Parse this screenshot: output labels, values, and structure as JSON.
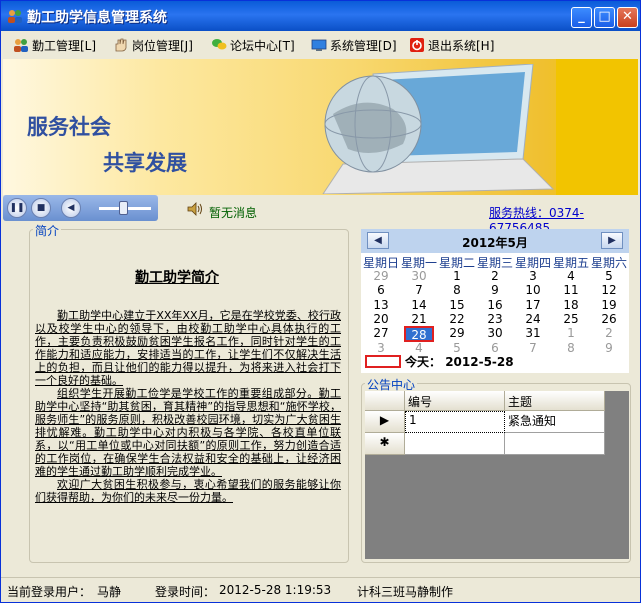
{
  "window": {
    "title": "勤工助学信息管理系统"
  },
  "menu": [
    {
      "label": "勤工管理[L]",
      "icon": "people-icon"
    },
    {
      "label": "岗位管理[J]",
      "icon": "hand-icon"
    },
    {
      "label": "论坛中心[T]",
      "icon": "chat-icon"
    },
    {
      "label": "系统管理[D]",
      "icon": "monitor-icon"
    },
    {
      "label": "退出系统[H]",
      "icon": "exit-icon"
    }
  ],
  "banner": {
    "line1": "服务社会",
    "line2": "共享发展"
  },
  "status": {
    "message": "暂无消息",
    "hotline": "服务热线：0374-67756485"
  },
  "intro": {
    "legend": "简介",
    "title": "勤工助学简介",
    "paragraphs": [
      "勤工助学中心建立于XX年XX月，它是在学校党委、校行政以及校学生中心的领导下，由校勤工助学中心具体执行的工作，主要负责积极鼓励贫困学生报名工作，同时针对学生的工作能力和适应能力，安排适当的工作，让学生们不仅解决生活上的负担，而且让他们的能力得以提升，为将来进入社会打下一个良好的基础。",
      "组织学生开展勤工俭学是学校工作的重要组成部分。勤工助学中心坚持“助其贫困，育其精神”的指导思想和“施怀学校，服务师生”的服务原则，积极改善校园环境，切实为广大贫困生排忧解难。勤工助学中心对内积极与各学院、各校直单位联系，以“用工单位或中心对同扶额”的原则工作，努力创造合适的工作岗位，在确保学生合法权益和安全的基础上，让经济困难的学生通过勤工助学顺利完成学业。",
      "欢迎广大贫困生积极参与，衷心希望我们的服务能够让你们获得帮助，为你们的未来尽一份力量。"
    ]
  },
  "calendar": {
    "month_label": "2012年5月",
    "weekdays": [
      "星期日",
      "星期一",
      "星期二",
      "星期三",
      "星期四",
      "星期五",
      "星期六"
    ],
    "weeks": [
      [
        {
          "d": "29",
          "o": true
        },
        {
          "d": "30",
          "o": true
        },
        {
          "d": "1"
        },
        {
          "d": "2"
        },
        {
          "d": "3"
        },
        {
          "d": "4"
        },
        {
          "d": "5"
        }
      ],
      [
        {
          "d": "6"
        },
        {
          "d": "7"
        },
        {
          "d": "8"
        },
        {
          "d": "9"
        },
        {
          "d": "10"
        },
        {
          "d": "11"
        },
        {
          "d": "12"
        }
      ],
      [
        {
          "d": "13"
        },
        {
          "d": "14"
        },
        {
          "d": "15"
        },
        {
          "d": "16"
        },
        {
          "d": "17"
        },
        {
          "d": "18"
        },
        {
          "d": "19"
        }
      ],
      [
        {
          "d": "20"
        },
        {
          "d": "21"
        },
        {
          "d": "22"
        },
        {
          "d": "23"
        },
        {
          "d": "24"
        },
        {
          "d": "25"
        },
        {
          "d": "26"
        }
      ],
      [
        {
          "d": "27"
        },
        {
          "d": "28",
          "s": true
        },
        {
          "d": "29"
        },
        {
          "d": "30"
        },
        {
          "d": "31"
        },
        {
          "d": "1",
          "o": true
        },
        {
          "d": "2",
          "o": true
        }
      ],
      [
        {
          "d": "3",
          "o": true
        },
        {
          "d": "4",
          "o": true
        },
        {
          "d": "5",
          "o": true
        },
        {
          "d": "6",
          "o": true
        },
        {
          "d": "7",
          "o": true
        },
        {
          "d": "8",
          "o": true
        },
        {
          "d": "9",
          "o": true
        }
      ]
    ],
    "today_label": "今天：",
    "today_value": "2012-5-28"
  },
  "notice": {
    "legend": "公告中心",
    "columns": [
      "编号",
      "主题"
    ],
    "rows": [
      {
        "marker": "▶",
        "id": "1",
        "subject": "紧急通知"
      }
    ],
    "new_row_marker": "✱"
  },
  "footer": {
    "user_label": "当前登录用户：",
    "user_value": "马静",
    "time_label": "登录时间：",
    "time_value": "2012-5-28 1:19:53",
    "credit": "计科三班马静制作"
  }
}
